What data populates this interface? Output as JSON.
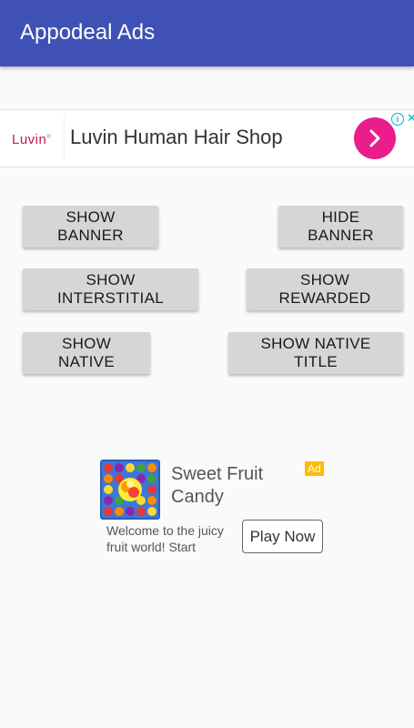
{
  "app_bar": {
    "title": "Appodeal Ads"
  },
  "banner_ad": {
    "logo": "Luvin",
    "headline": "Luvin Human Hair Shop",
    "accent": "#e91e8c",
    "info_icon": "info-icon",
    "close_icon": "close-icon"
  },
  "buttons": {
    "show_banner": "SHOW BANNER",
    "hide_banner": "HIDE BANNER",
    "show_interstitial": "SHOW INTERSTITIAL",
    "show_rewarded": "SHOW REWARDED",
    "show_native": "SHOW NATIVE",
    "show_native_title": "SHOW NATIVE TITLE"
  },
  "native_ad": {
    "title": "Sweet Fruit Candy",
    "badge": "Ad",
    "description": "Welcome to the juicy fruit world! Start",
    "cta": "Play Now"
  },
  "colors": {
    "primary": "#3f51b5",
    "button_bg": "#d6d6d6",
    "ad_badge": "#fbbc05"
  }
}
